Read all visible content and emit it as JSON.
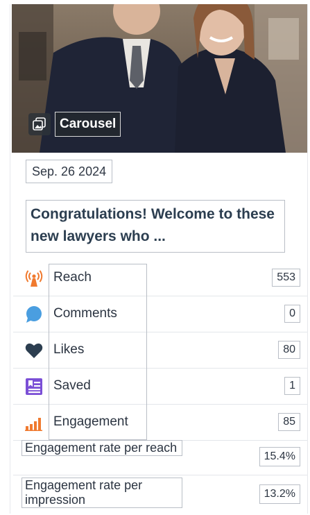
{
  "post": {
    "type_label": "Carousel",
    "date": "Sep. 26 2024",
    "title": "Congratulations! Welcome to these new lawyers who ..."
  },
  "metrics": [
    {
      "label": "Reach",
      "value": "553",
      "icon": "broadcast-tower-icon",
      "color": "#f07a2f"
    },
    {
      "label": "Comments",
      "value": "0",
      "icon": "speech-bubble-icon",
      "color": "#4a9ee0"
    },
    {
      "label": "Likes",
      "value": "80",
      "icon": "heart-icon",
      "color": "#2c3e50"
    },
    {
      "label": "Saved",
      "value": "1",
      "icon": "bookmark-list-icon",
      "color": "#7b4fd6"
    },
    {
      "label": "Engagement",
      "value": "85",
      "icon": "bar-chart-icon",
      "color": "#f07a2f"
    }
  ],
  "rates": [
    {
      "label": "Engagement rate per reach",
      "value": "15.4%"
    },
    {
      "label": "Engagement rate per impression",
      "value": "13.2%"
    }
  ]
}
